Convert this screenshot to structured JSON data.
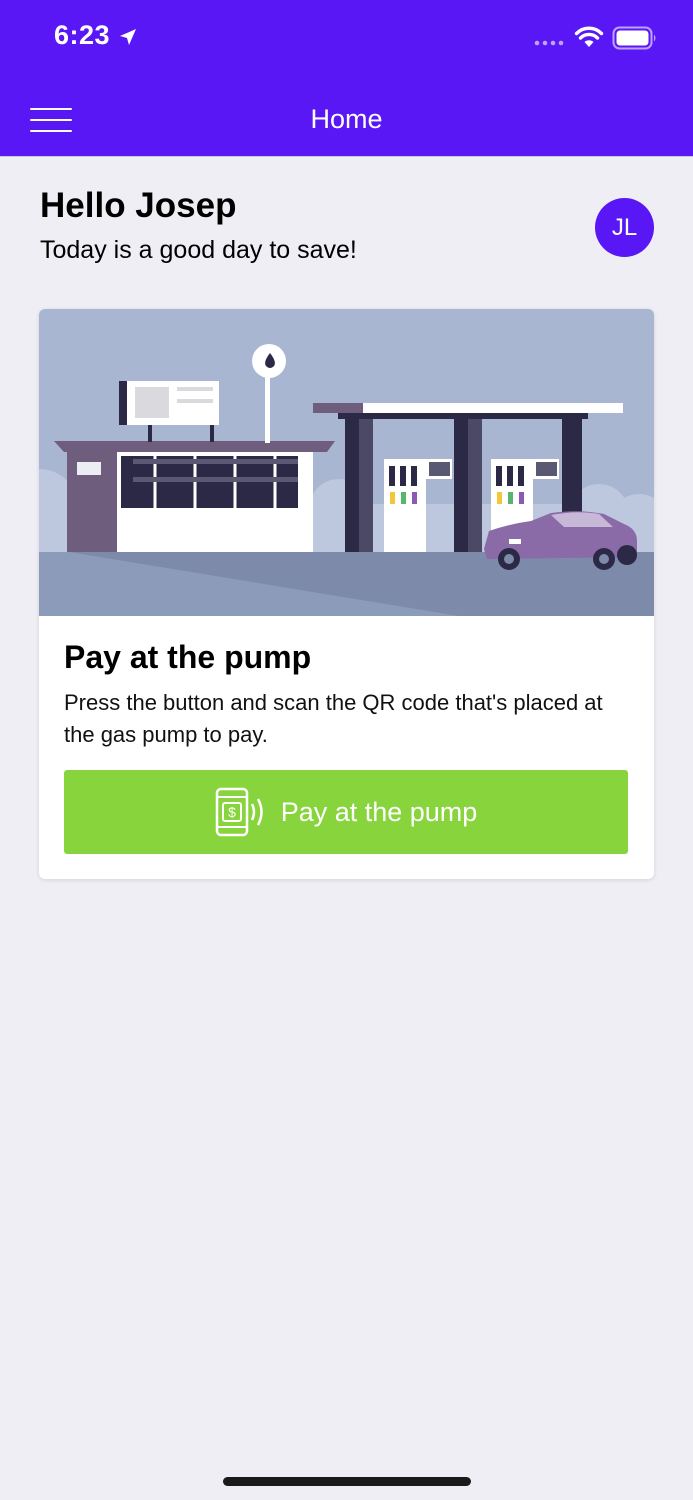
{
  "status_bar": {
    "time": "6:23"
  },
  "header": {
    "title": "Home"
  },
  "greeting": {
    "title": "Hello Josep",
    "subtitle": "Today is a good day to save!",
    "avatar_initials": "JL"
  },
  "card": {
    "title": "Pay at the pump",
    "description": "Press the button and scan the QR code that's placed at the gas pump to pay.",
    "button_label": "Pay at the pump"
  },
  "colors": {
    "brand": "#5a17f5",
    "action": "#88d43c",
    "background": "#efeef4"
  },
  "icons": [
    "location-arrow-icon",
    "signal-icon",
    "wifi-icon",
    "battery-icon",
    "menu-icon",
    "phone-dollar-icon"
  ]
}
